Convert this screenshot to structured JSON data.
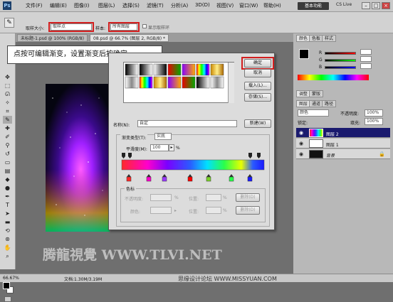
{
  "app": {
    "logo": "Ps",
    "menu": [
      "文件(F)",
      "编辑(E)",
      "图像(I)",
      "图层(L)",
      "选择(S)",
      "滤镜(T)",
      "分析(A)",
      "3D(D)",
      "视图(V)",
      "窗口(W)",
      "帮助(H)"
    ],
    "workspace_button": "基本功能",
    "cs_live": "CS Live",
    "window_controls": [
      "–",
      "□",
      "×"
    ]
  },
  "options_bar": {
    "sample_size_label": "取样大小:",
    "sample_size_value": "取样点",
    "sample_label": "样本:",
    "sample_value": "所有图层",
    "show_ring_label": "显示取样环"
  },
  "document_tabs": [
    {
      "label": "未标题-1.psd @ 100% (RGB/8)"
    },
    {
      "label": "08.psd @ 66.7% (图层 2, RGB/8) *"
    }
  ],
  "callout": {
    "text": "点按可编辑渐变，设置渐变后按确定"
  },
  "gradient_editor": {
    "title": "渐变编辑器",
    "presets_label": "预设",
    "buttons": {
      "ok": "确定",
      "cancel": "取消",
      "load": "载入(L)...",
      "save": "存储(S)...",
      "new": "新建(W)"
    },
    "name_label": "名称(N):",
    "name_value": "自定",
    "type_label": "渐变类型(T):",
    "type_value": "实底",
    "smoothness_label": "平滑度(M):",
    "smoothness_value": "100",
    "smoothness_unit": "%",
    "stops_group_label": "色标",
    "opacity_label": "不透明度:",
    "location_label": "位置:",
    "percent": "%",
    "delete_label": "删除(D)",
    "color_label": "颜色:",
    "gradient_colors": [
      "#ff2a2a",
      "#ff00cc",
      "#7a00ff",
      "#2a5bff",
      "#00e0ff",
      "#2aff4a",
      "#e8ff00",
      "#ff9a00",
      "#ff0000",
      "#1a1aff"
    ]
  },
  "right_panel": {
    "color_tabs": [
      "颜色",
      "色板",
      "样式"
    ],
    "rgb_labels": [
      "R",
      "G",
      "B"
    ],
    "adjust_tabs": [
      "调整",
      "蒙版"
    ],
    "layer_tabs": [
      "图层",
      "通道",
      "路径"
    ],
    "blend_mode": "颜色",
    "opacity_label": "不透明度:",
    "opacity_value": "100%",
    "lock_label": "锁定:",
    "fill_label": "填充:",
    "fill_value": "100%",
    "layers": [
      {
        "name": "图层 2",
        "selected": true
      },
      {
        "name": "图层 1",
        "selected": false
      },
      {
        "name": "背景",
        "selected": false
      }
    ]
  },
  "status_bar": {
    "zoom": "66.67%",
    "doc_info": "文档:1.30M/3.19M"
  },
  "watermarks": {
    "main": "腾龍視覺 WWW.TLVI.NET",
    "site": "思缘设计论坛 WWW.MISSYUAN.COM"
  },
  "accent_color": "#d21e1e",
  "selection_color": "#1a1a6e"
}
